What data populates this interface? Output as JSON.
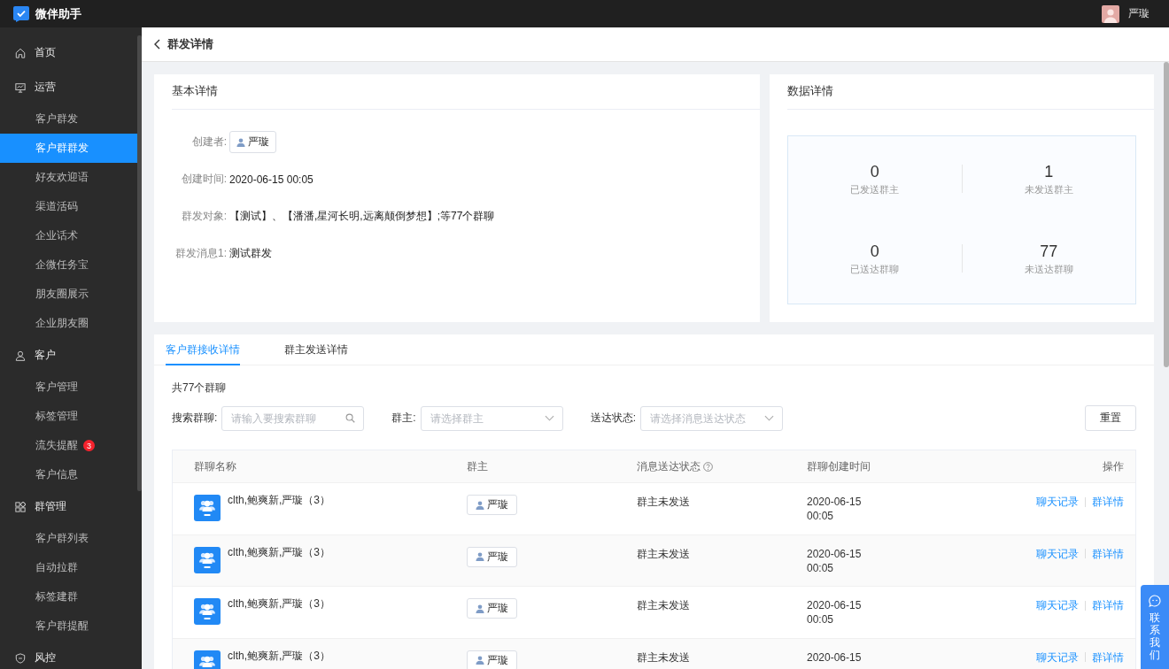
{
  "topbar": {
    "app_name": "微伴助手",
    "user_name": "严璇"
  },
  "sidebar": {
    "items": [
      {
        "label": "首页",
        "selected": false
      },
      {
        "label": "运营",
        "selected": false,
        "children": [
          {
            "label": "客户群发",
            "selected": false
          },
          {
            "label": "客户群群发",
            "selected": true
          },
          {
            "label": "好友欢迎语",
            "selected": false
          },
          {
            "label": "渠道活码",
            "selected": false
          },
          {
            "label": "企业话术",
            "selected": false
          },
          {
            "label": "企微任务宝",
            "selected": false
          },
          {
            "label": "朋友圈展示",
            "selected": false
          },
          {
            "label": "企业朋友圈",
            "selected": false
          }
        ]
      },
      {
        "label": "客户",
        "selected": false,
        "children": [
          {
            "label": "客户管理",
            "selected": false
          },
          {
            "label": "标签管理",
            "selected": false
          },
          {
            "label": "流失提醒",
            "selected": false,
            "badge": "3"
          },
          {
            "label": "客户信息",
            "selected": false
          }
        ]
      },
      {
        "label": "群管理",
        "selected": false,
        "children": [
          {
            "label": "客户群列表",
            "selected": false
          },
          {
            "label": "自动拉群",
            "selected": false
          },
          {
            "label": "标签建群",
            "selected": false
          },
          {
            "label": "客户群提醒",
            "selected": false
          }
        ]
      },
      {
        "label": "风控",
        "selected": false
      }
    ]
  },
  "page_header": {
    "title": "群发详情"
  },
  "basic_details": {
    "title": "基本详情",
    "fields": [
      {
        "label": "创建者:",
        "kind": "user",
        "value": "严璇"
      },
      {
        "label": "创建时间:",
        "kind": "text",
        "value": "2020-06-15 00:05"
      },
      {
        "label": "群发对象:",
        "kind": "text",
        "value": "【测试】、【潘潘,星河长明,远离颠倒梦想】;等77个群聊"
      },
      {
        "label": "群发消息1:",
        "kind": "text",
        "value": "测试群发"
      }
    ]
  },
  "data_details": {
    "title": "数据详情",
    "stats": [
      {
        "value": "0",
        "label": "已发送群主"
      },
      {
        "value": "1",
        "label": "未发送群主"
      },
      {
        "value": "0",
        "label": "已送达群聊"
      },
      {
        "value": "77",
        "label": "未送达群聊"
      }
    ]
  },
  "tabs": [
    {
      "label": "客户群接收详情",
      "selected": true
    },
    {
      "label": "群主发送详情",
      "selected": false
    }
  ],
  "group_count": "共77个群聊",
  "filters": [
    {
      "label": "搜索群聊:",
      "kind": "search",
      "placeholder": "请输入要搜索群聊"
    },
    {
      "label": "群主:",
      "kind": "select",
      "placeholder": "请选择群主"
    },
    {
      "label": "送达状态:",
      "kind": "select",
      "placeholder": "请选择消息送达状态"
    }
  ],
  "reset_button": "重置",
  "table": {
    "columns": [
      {
        "label": "群聊名称",
        "kind": "plain"
      },
      {
        "label": "群主",
        "kind": "plain"
      },
      {
        "label": "消息送达状态",
        "kind": "help"
      },
      {
        "label": "群聊创建时间",
        "kind": "plain"
      },
      {
        "label": "操作",
        "kind": "actions"
      }
    ],
    "rows": [
      {
        "name": "clth,鲍爽新,严璇（3）",
        "owner": "严璇",
        "status": "群主未发送",
        "created": "2020-06-15 00:05",
        "actions": [
          "聊天记录",
          "群详情"
        ]
      },
      {
        "name": "clth,鲍爽新,严璇（3）",
        "owner": "严璇",
        "status": "群主未发送",
        "created": "2020-06-15 00:05",
        "actions": [
          "聊天记录",
          "群详情"
        ]
      },
      {
        "name": "clth,鲍爽新,严璇（3）",
        "owner": "严璇",
        "status": "群主未发送",
        "created": "2020-06-15 00:05",
        "actions": [
          "聊天记录",
          "群详情"
        ]
      },
      {
        "name": "clth,鲍爽新,严璇（3）",
        "owner": "严璇",
        "status": "群主未发送",
        "created": "2020-06-15",
        "actions": [
          "聊天记录",
          "群详情"
        ]
      }
    ]
  },
  "contact_button": "联系我们"
}
